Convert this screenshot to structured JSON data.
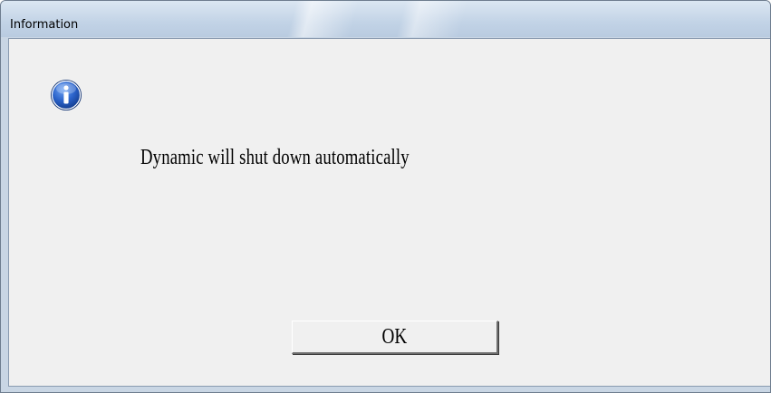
{
  "window": {
    "title": "Information"
  },
  "dialog": {
    "icon": "information-icon",
    "message": "Dynamic will shut down automatically",
    "ok_label": "OK"
  },
  "colors": {
    "titlebar": "#c2d3e6",
    "client_background": "#f0f0f0",
    "icon_blue": "#1c4fb0"
  }
}
